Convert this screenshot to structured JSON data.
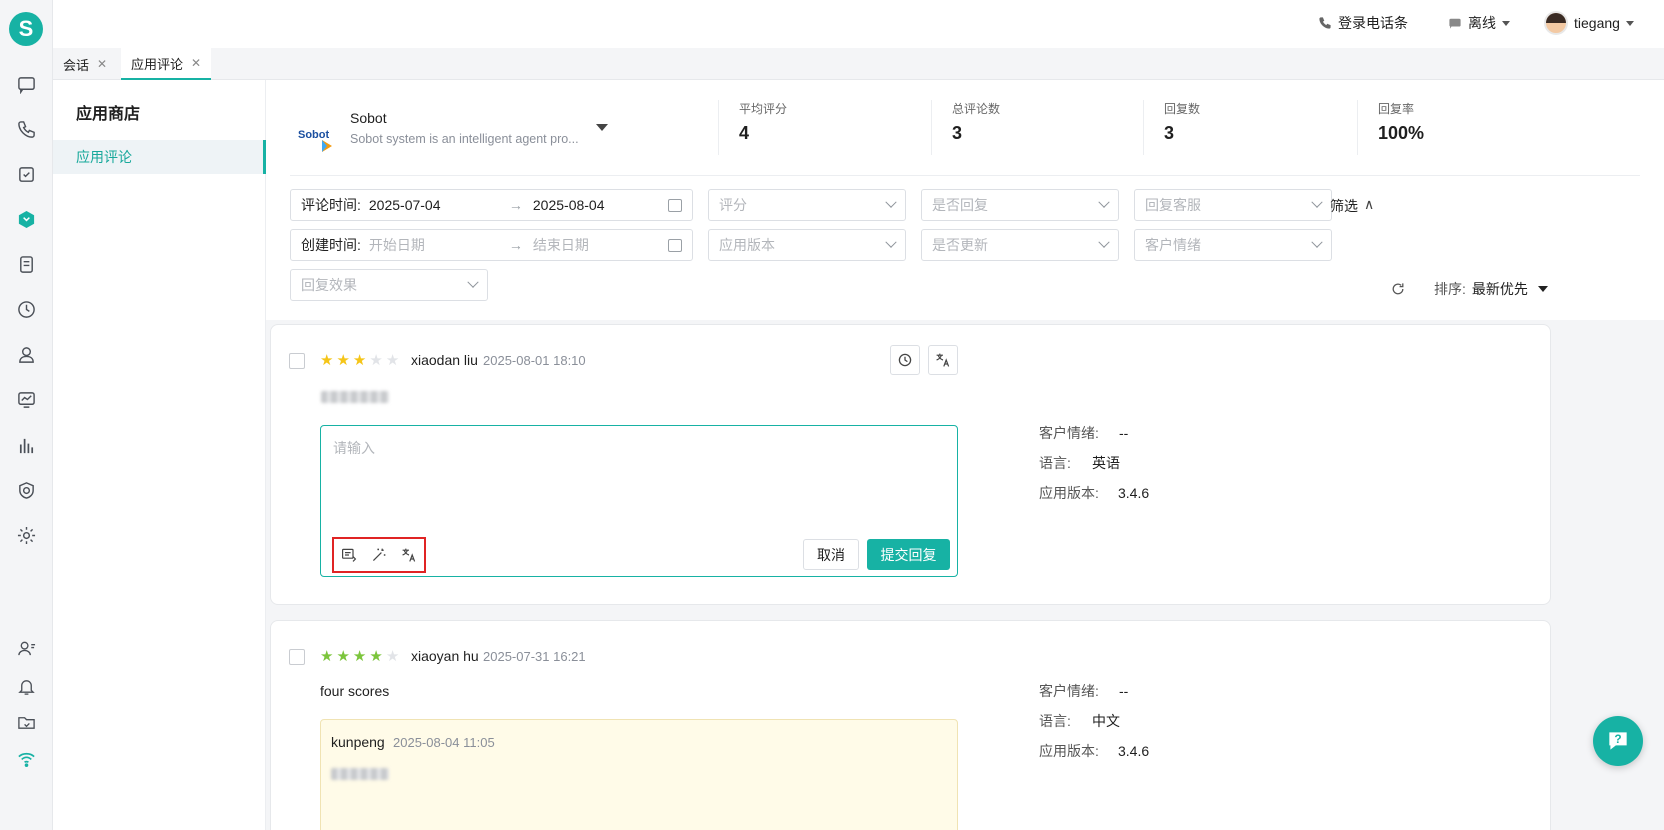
{
  "brand": {
    "logo_letter": "S",
    "accent": "#17b2a4"
  },
  "rail": {
    "icons": [
      "chat-icon",
      "phone-icon",
      "task-icon",
      "app-store-icon",
      "document-icon",
      "history-icon",
      "customer-icon",
      "monitor-icon",
      "report-icon",
      "security-icon",
      "settings-icon",
      "agent-status-icon",
      "bell-icon",
      "folder-icon",
      "wifi-icon"
    ]
  },
  "topbar": {
    "phone_bar": "登录电话条",
    "status": "离线",
    "user": "tiegang"
  },
  "tabs": [
    {
      "label": "会话",
      "close": "✕"
    },
    {
      "label": "应用评论",
      "close": "✕"
    }
  ],
  "sidebar": {
    "title": "应用商店",
    "items": [
      {
        "label": "应用评论"
      }
    ]
  },
  "app": {
    "logo_text": "Sobot",
    "name": "Sobot",
    "desc": "Sobot system is an intelligent agent pro..."
  },
  "stats": [
    {
      "label": "平均评分",
      "value": "4"
    },
    {
      "label": "总评论数",
      "value": "3"
    },
    {
      "label": "回复数",
      "value": "3"
    },
    {
      "label": "回复率",
      "value": "100%"
    }
  ],
  "filters": {
    "review_time": {
      "label": "评论时间:",
      "start": "2025-07-04",
      "end": "2025-08-04"
    },
    "create_time": {
      "label": "创建时间:",
      "start": "开始日期",
      "end": "结束日期"
    },
    "range_arrow": "→",
    "rating": "评分",
    "replied": "是否回复",
    "reply_agent": "回复客服",
    "app_version": "应用版本",
    "updated": "是否更新",
    "sentiment": "客户情绪",
    "reply_effect": "回复效果",
    "toggle": "筛选",
    "toggle_arrow": "∧",
    "sort_label": "排序:",
    "sort_value": "最新优先"
  },
  "reviews": [
    {
      "rating": 3,
      "user": "xiaodan liu",
      "time": "2025-08-01 18:10",
      "reply_placeholder": "请输入",
      "cancel": "取消",
      "submit": "提交回复",
      "sentiment_label": "客户情绪:",
      "sentiment": "--",
      "language_label": "语言:",
      "language": "英语",
      "version_label": "应用版本:",
      "version": "3.4.6"
    },
    {
      "rating": 4,
      "user": "xiaoyan hu",
      "time": "2025-07-31 16:21",
      "content": "four scores",
      "reply_user": "kunpeng",
      "reply_time": "2025-08-04 11:05",
      "sentiment_label": "客户情绪:",
      "sentiment": "--",
      "language_label": "语言:",
      "language": "中文",
      "version_label": "应用版本:",
      "version": "3.4.6"
    }
  ]
}
